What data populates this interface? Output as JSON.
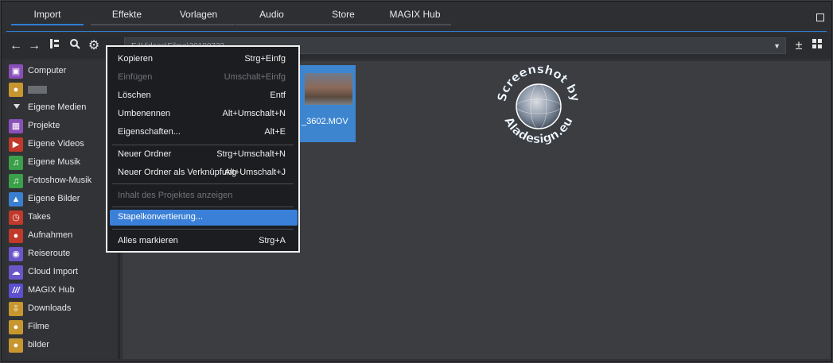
{
  "tabs": [
    {
      "label": "Import",
      "active": true
    },
    {
      "label": "Effekte",
      "active": false
    },
    {
      "label": "Vorlagen",
      "active": false
    },
    {
      "label": "Audio",
      "active": false
    },
    {
      "label": "Store",
      "active": false
    },
    {
      "label": "MAGIX Hub",
      "active": false
    }
  ],
  "toolbar": {
    "icons": [
      "back-arrow-icon",
      "forward-arrow-icon",
      "tree-view-icon",
      "search-icon",
      "gear-icon",
      "upload-icon"
    ],
    "path_text": "E:\\Videos\\Filme\\20190723",
    "right_icons": [
      "sort-icon",
      "grid-view-icon"
    ]
  },
  "sidebar": {
    "items": [
      {
        "label": "Computer",
        "icon": "computer-icon",
        "color": "#8a4fb8"
      },
      {
        "label": "",
        "icon": "user-folder-icon",
        "color": "#c8962f"
      },
      {
        "label": "Eigene Medien",
        "icon": "expand-triangle-icon",
        "color": ""
      },
      {
        "label": "Projekte",
        "icon": "project-icon",
        "color": "#8a4fb8"
      },
      {
        "label": "Eigene Videos",
        "icon": "video-icon",
        "color": "#c0392b"
      },
      {
        "label": "Eigene Musik",
        "icon": "music-icon",
        "color": "#3aa04a"
      },
      {
        "label": "Fotoshow-Musik",
        "icon": "music-icon",
        "color": "#3aa04a"
      },
      {
        "label": "Eigene Bilder",
        "icon": "image-icon",
        "color": "#3b7fd0"
      },
      {
        "label": "Takes",
        "icon": "timer-icon",
        "color": "#c0392b"
      },
      {
        "label": "Aufnahmen",
        "icon": "record-icon",
        "color": "#c0392b"
      },
      {
        "label": "Reiseroute",
        "icon": "location-icon",
        "color": "#6a56c8"
      },
      {
        "label": "Cloud Import",
        "icon": "cloud-icon",
        "color": "#6a56c8"
      },
      {
        "label": "MAGIX Hub",
        "icon": "hub-icon",
        "color": "#5c4fd0"
      },
      {
        "label": "Downloads",
        "icon": "download-icon",
        "color": "#c8962f"
      },
      {
        "label": "Filme",
        "icon": "user-folder-icon",
        "color": "#c8962f"
      },
      {
        "label": "bilder",
        "icon": "user-folder-icon",
        "color": "#c8962f"
      }
    ]
  },
  "file": {
    "caption": "_3602.MOV",
    "selected": true
  },
  "watermark": {
    "line1": "Screenshot by",
    "line2": "Aladesign.eu"
  },
  "menu": {
    "items": [
      {
        "label": "Kopieren",
        "shortcut": "Strg+Einfg",
        "disabled": false
      },
      {
        "label": "Einfügen",
        "shortcut": "Umschalt+Einfg",
        "disabled": true
      },
      {
        "label": "Löschen",
        "shortcut": "Entf",
        "disabled": false
      },
      {
        "label": "Umbenennen",
        "shortcut": "Alt+Umschalt+N",
        "disabled": false
      },
      {
        "label": "Eigenschaften...",
        "shortcut": "Alt+E",
        "disabled": false
      },
      {
        "label": "Neuer Ordner",
        "shortcut": "Strg+Umschalt+N",
        "disabled": false
      },
      {
        "label": "Neuer Ordner als Verknüpfung",
        "shortcut": "Alt+Umschalt+J",
        "disabled": false
      },
      {
        "label": "Inhalt des Projektes anzeigen",
        "shortcut": "",
        "disabled": true
      },
      {
        "label": "Stapelkonvertierung...",
        "shortcut": "",
        "disabled": false,
        "highlighted": true
      },
      {
        "label": "Alles markieren",
        "shortcut": "Strg+A",
        "disabled": false
      }
    ]
  },
  "colors": {
    "accent": "#2f7fd6",
    "highlight": "#3b80d8",
    "selection": "#3d86cf"
  }
}
